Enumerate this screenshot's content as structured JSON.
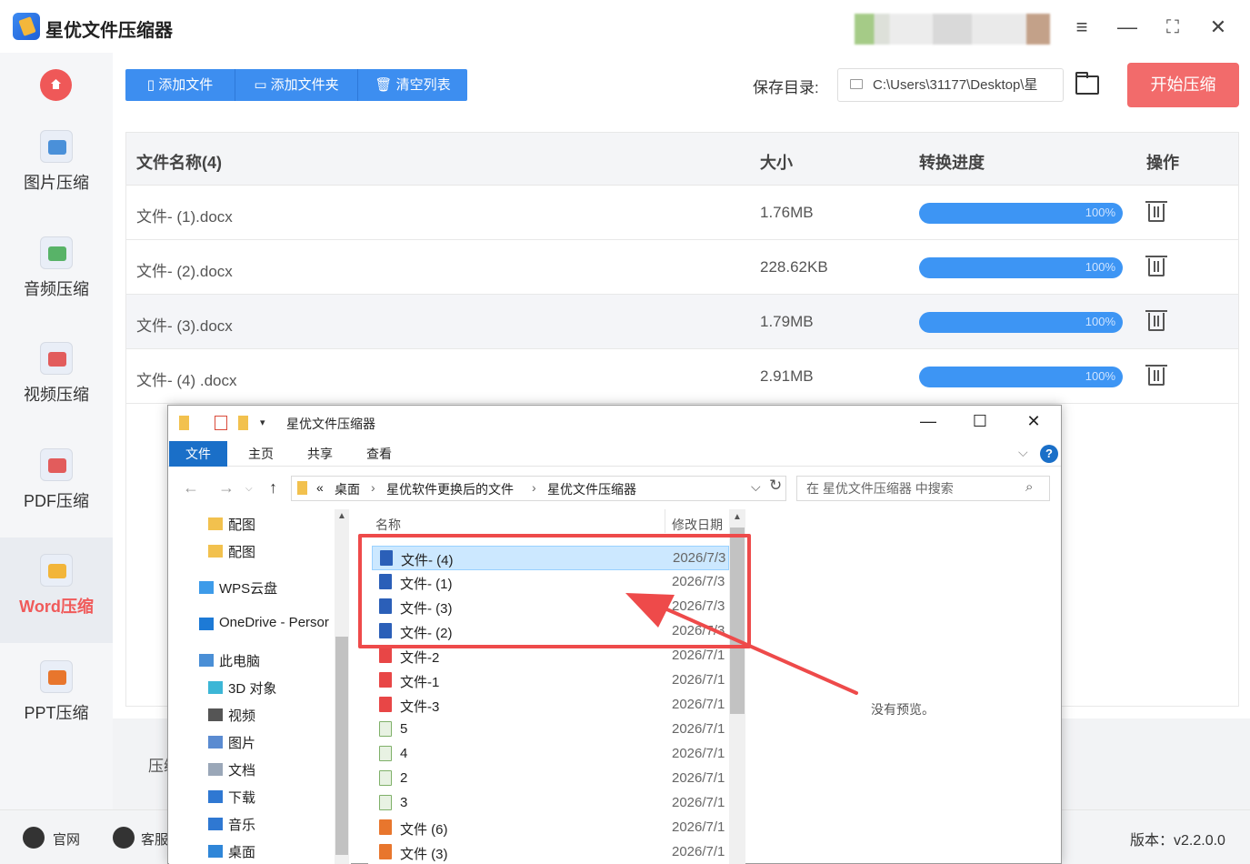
{
  "app": {
    "title": "星优文件压缩器"
  },
  "window_controls": {
    "settings": "≡",
    "minimize": "—",
    "maximize": "⛶",
    "close": "✕"
  },
  "sidebar": {
    "items": [
      {
        "label": "图片压缩",
        "icon": "image-compress-icon",
        "color": "#4a90d9"
      },
      {
        "label": "音频压缩",
        "icon": "audio-compress-icon",
        "color": "#58b368"
      },
      {
        "label": "视频压缩",
        "icon": "video-compress-icon",
        "color": "#e25c5c"
      },
      {
        "label": "PDF压缩",
        "icon": "pdf-compress-icon",
        "color": "#e25c5c"
      },
      {
        "label": "Word压缩",
        "icon": "word-compress-icon",
        "color": "#f2b53a"
      },
      {
        "label": "PPT压缩",
        "icon": "ppt-compress-icon",
        "color": "#e8762d"
      }
    ],
    "active_index": 4
  },
  "toolbar": {
    "add_file": "添加文件",
    "add_folder": "添加文件夹",
    "clear_list": "清空列表",
    "save_label": "保存目录:",
    "save_path": "C:\\Users\\31177\\Desktop\\星",
    "start": "开始压缩"
  },
  "table": {
    "headers": {
      "name": "文件名称(4)",
      "size": "大小",
      "progress": "转换进度",
      "action": "操作"
    },
    "rows": [
      {
        "name": "文件- (1).docx",
        "size": "1.76MB",
        "progress": "100%",
        "progress_value": 1.0
      },
      {
        "name": "文件- (2).docx",
        "size": "228.62KB",
        "progress": "100%",
        "progress_value": 1.0
      },
      {
        "name": "文件- (3).docx",
        "size": "1.79MB",
        "progress": "100%",
        "progress_value": 1.0
      },
      {
        "name": "文件- (4) .docx",
        "size": "2.91MB",
        "progress": "100%",
        "progress_value": 1.0
      }
    ]
  },
  "bottom": {
    "partial_label": "压缩"
  },
  "footer": {
    "website": "官网",
    "service": "客服",
    "version": "版本：v2.2.0.0"
  },
  "explorer": {
    "title": "星优文件压缩器",
    "ribbon_tabs": [
      "文件",
      "主页",
      "共享",
      "查看"
    ],
    "breadcrumb": [
      "桌面",
      "星优软件更换后的文件",
      "星优文件压缩器"
    ],
    "breadcrumb_prefix": "«",
    "search_placeholder": "在 星优文件压缩器 中搜索",
    "tree": [
      {
        "label": "配图",
        "icon": "folder-icon"
      },
      {
        "label": "配图",
        "icon": "folder-icon"
      },
      {
        "label": "WPS云盘",
        "icon": "cloud-icon"
      },
      {
        "label": "OneDrive - Persor",
        "icon": "onedrive-icon"
      },
      {
        "label": "此电脑",
        "icon": "computer-icon"
      },
      {
        "label": "3D 对象",
        "icon": "3d-objects-icon"
      },
      {
        "label": "视频",
        "icon": "video-folder-icon"
      },
      {
        "label": "图片",
        "icon": "pictures-folder-icon"
      },
      {
        "label": "文档",
        "icon": "documents-folder-icon"
      },
      {
        "label": "下载",
        "icon": "download-folder-icon"
      },
      {
        "label": "音乐",
        "icon": "music-folder-icon"
      },
      {
        "label": "桌面",
        "icon": "desktop-folder-icon"
      }
    ],
    "columns": {
      "name": "名称",
      "date": "修改日期"
    },
    "files": [
      {
        "name": "文件- (4)",
        "date": "2026/7/3",
        "type": "word"
      },
      {
        "name": "文件- (1)",
        "date": "2026/7/3",
        "type": "word"
      },
      {
        "name": "文件- (3)",
        "date": "2026/7/3",
        "type": "word"
      },
      {
        "name": "文件- (2)",
        "date": "2026/7/3",
        "type": "word"
      },
      {
        "name": "文件-2",
        "date": "2026/7/1",
        "type": "wps"
      },
      {
        "name": "文件-1",
        "date": "2026/7/1",
        "type": "wps"
      },
      {
        "name": "文件-3",
        "date": "2026/7/1",
        "type": "wps"
      },
      {
        "name": "5",
        "date": "2026/7/1",
        "type": "img"
      },
      {
        "name": "4",
        "date": "2026/7/1",
        "type": "img"
      },
      {
        "name": "2",
        "date": "2026/7/1",
        "type": "img"
      },
      {
        "name": "3",
        "date": "2026/7/1",
        "type": "img"
      },
      {
        "name": "文件 (6)",
        "date": "2026/7/1",
        "type": "ppt"
      },
      {
        "name": "文件 (3)",
        "date": "2026/7/1",
        "type": "ppt"
      }
    ],
    "no_preview": "没有预览。"
  },
  "colors": {
    "accent_blue": "#3d8ef0",
    "start_red": "#f26b6b",
    "annotation_red": "#ee4a4a",
    "progress_blue": "#3d95f4"
  }
}
